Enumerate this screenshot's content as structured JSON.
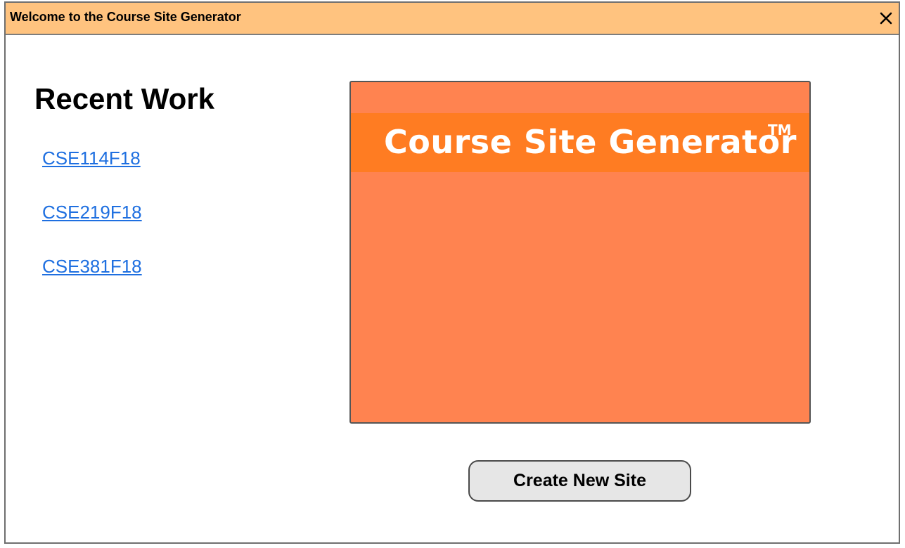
{
  "window": {
    "title": "Welcome to the Course Site Generator",
    "close_icon": "close-icon"
  },
  "recent": {
    "heading": "Recent Work",
    "items": [
      {
        "label": "CSE114F18"
      },
      {
        "label": "CSE219F18"
      },
      {
        "label": "CSE381F18"
      }
    ]
  },
  "logo": {
    "text": "Course Site Generator",
    "trademark": "TM"
  },
  "actions": {
    "create_label": "Create New Site"
  },
  "colors": {
    "titlebar": "#ffc37f",
    "logo_panel": "#ff8350",
    "logo_band": "#ff7c22",
    "link": "#1e6fe0",
    "button": "#e6e6e6"
  }
}
